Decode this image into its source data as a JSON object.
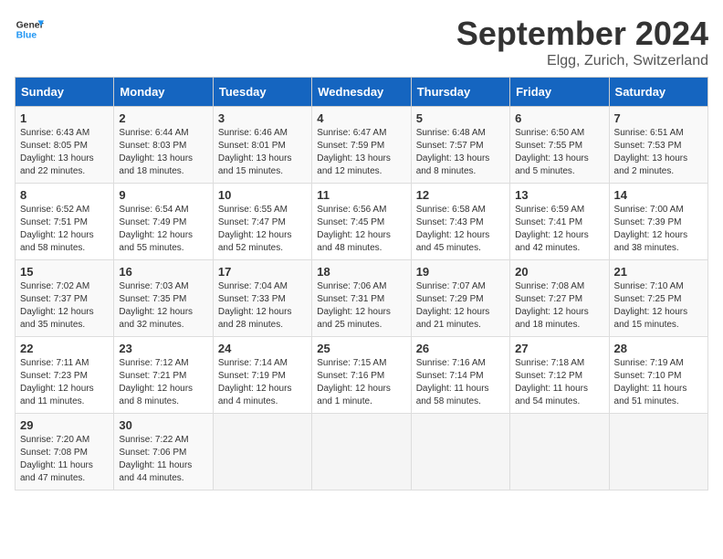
{
  "header": {
    "logo_line1": "General",
    "logo_line2": "Blue",
    "month": "September 2024",
    "location": "Elgg, Zurich, Switzerland"
  },
  "weekdays": [
    "Sunday",
    "Monday",
    "Tuesday",
    "Wednesday",
    "Thursday",
    "Friday",
    "Saturday"
  ],
  "weeks": [
    [
      {
        "day": "1",
        "lines": [
          "Sunrise: 6:43 AM",
          "Sunset: 8:05 PM",
          "Daylight: 13 hours",
          "and 22 minutes."
        ]
      },
      {
        "day": "2",
        "lines": [
          "Sunrise: 6:44 AM",
          "Sunset: 8:03 PM",
          "Daylight: 13 hours",
          "and 18 minutes."
        ]
      },
      {
        "day": "3",
        "lines": [
          "Sunrise: 6:46 AM",
          "Sunset: 8:01 PM",
          "Daylight: 13 hours",
          "and 15 minutes."
        ]
      },
      {
        "day": "4",
        "lines": [
          "Sunrise: 6:47 AM",
          "Sunset: 7:59 PM",
          "Daylight: 13 hours",
          "and 12 minutes."
        ]
      },
      {
        "day": "5",
        "lines": [
          "Sunrise: 6:48 AM",
          "Sunset: 7:57 PM",
          "Daylight: 13 hours",
          "and 8 minutes."
        ]
      },
      {
        "day": "6",
        "lines": [
          "Sunrise: 6:50 AM",
          "Sunset: 7:55 PM",
          "Daylight: 13 hours",
          "and 5 minutes."
        ]
      },
      {
        "day": "7",
        "lines": [
          "Sunrise: 6:51 AM",
          "Sunset: 7:53 PM",
          "Daylight: 13 hours",
          "and 2 minutes."
        ]
      }
    ],
    [
      {
        "day": "8",
        "lines": [
          "Sunrise: 6:52 AM",
          "Sunset: 7:51 PM",
          "Daylight: 12 hours",
          "and 58 minutes."
        ]
      },
      {
        "day": "9",
        "lines": [
          "Sunrise: 6:54 AM",
          "Sunset: 7:49 PM",
          "Daylight: 12 hours",
          "and 55 minutes."
        ]
      },
      {
        "day": "10",
        "lines": [
          "Sunrise: 6:55 AM",
          "Sunset: 7:47 PM",
          "Daylight: 12 hours",
          "and 52 minutes."
        ]
      },
      {
        "day": "11",
        "lines": [
          "Sunrise: 6:56 AM",
          "Sunset: 7:45 PM",
          "Daylight: 12 hours",
          "and 48 minutes."
        ]
      },
      {
        "day": "12",
        "lines": [
          "Sunrise: 6:58 AM",
          "Sunset: 7:43 PM",
          "Daylight: 12 hours",
          "and 45 minutes."
        ]
      },
      {
        "day": "13",
        "lines": [
          "Sunrise: 6:59 AM",
          "Sunset: 7:41 PM",
          "Daylight: 12 hours",
          "and 42 minutes."
        ]
      },
      {
        "day": "14",
        "lines": [
          "Sunrise: 7:00 AM",
          "Sunset: 7:39 PM",
          "Daylight: 12 hours",
          "and 38 minutes."
        ]
      }
    ],
    [
      {
        "day": "15",
        "lines": [
          "Sunrise: 7:02 AM",
          "Sunset: 7:37 PM",
          "Daylight: 12 hours",
          "and 35 minutes."
        ]
      },
      {
        "day": "16",
        "lines": [
          "Sunrise: 7:03 AM",
          "Sunset: 7:35 PM",
          "Daylight: 12 hours",
          "and 32 minutes."
        ]
      },
      {
        "day": "17",
        "lines": [
          "Sunrise: 7:04 AM",
          "Sunset: 7:33 PM",
          "Daylight: 12 hours",
          "and 28 minutes."
        ]
      },
      {
        "day": "18",
        "lines": [
          "Sunrise: 7:06 AM",
          "Sunset: 7:31 PM",
          "Daylight: 12 hours",
          "and 25 minutes."
        ]
      },
      {
        "day": "19",
        "lines": [
          "Sunrise: 7:07 AM",
          "Sunset: 7:29 PM",
          "Daylight: 12 hours",
          "and 21 minutes."
        ]
      },
      {
        "day": "20",
        "lines": [
          "Sunrise: 7:08 AM",
          "Sunset: 7:27 PM",
          "Daylight: 12 hours",
          "and 18 minutes."
        ]
      },
      {
        "day": "21",
        "lines": [
          "Sunrise: 7:10 AM",
          "Sunset: 7:25 PM",
          "Daylight: 12 hours",
          "and 15 minutes."
        ]
      }
    ],
    [
      {
        "day": "22",
        "lines": [
          "Sunrise: 7:11 AM",
          "Sunset: 7:23 PM",
          "Daylight: 12 hours",
          "and 11 minutes."
        ]
      },
      {
        "day": "23",
        "lines": [
          "Sunrise: 7:12 AM",
          "Sunset: 7:21 PM",
          "Daylight: 12 hours",
          "and 8 minutes."
        ]
      },
      {
        "day": "24",
        "lines": [
          "Sunrise: 7:14 AM",
          "Sunset: 7:19 PM",
          "Daylight: 12 hours",
          "and 4 minutes."
        ]
      },
      {
        "day": "25",
        "lines": [
          "Sunrise: 7:15 AM",
          "Sunset: 7:16 PM",
          "Daylight: 12 hours",
          "and 1 minute."
        ]
      },
      {
        "day": "26",
        "lines": [
          "Sunrise: 7:16 AM",
          "Sunset: 7:14 PM",
          "Daylight: 11 hours",
          "and 58 minutes."
        ]
      },
      {
        "day": "27",
        "lines": [
          "Sunrise: 7:18 AM",
          "Sunset: 7:12 PM",
          "Daylight: 11 hours",
          "and 54 minutes."
        ]
      },
      {
        "day": "28",
        "lines": [
          "Sunrise: 7:19 AM",
          "Sunset: 7:10 PM",
          "Daylight: 11 hours",
          "and 51 minutes."
        ]
      }
    ],
    [
      {
        "day": "29",
        "lines": [
          "Sunrise: 7:20 AM",
          "Sunset: 7:08 PM",
          "Daylight: 11 hours",
          "and 47 minutes."
        ]
      },
      {
        "day": "30",
        "lines": [
          "Sunrise: 7:22 AM",
          "Sunset: 7:06 PM",
          "Daylight: 11 hours",
          "and 44 minutes."
        ]
      },
      {
        "day": "",
        "lines": []
      },
      {
        "day": "",
        "lines": []
      },
      {
        "day": "",
        "lines": []
      },
      {
        "day": "",
        "lines": []
      },
      {
        "day": "",
        "lines": []
      }
    ]
  ]
}
